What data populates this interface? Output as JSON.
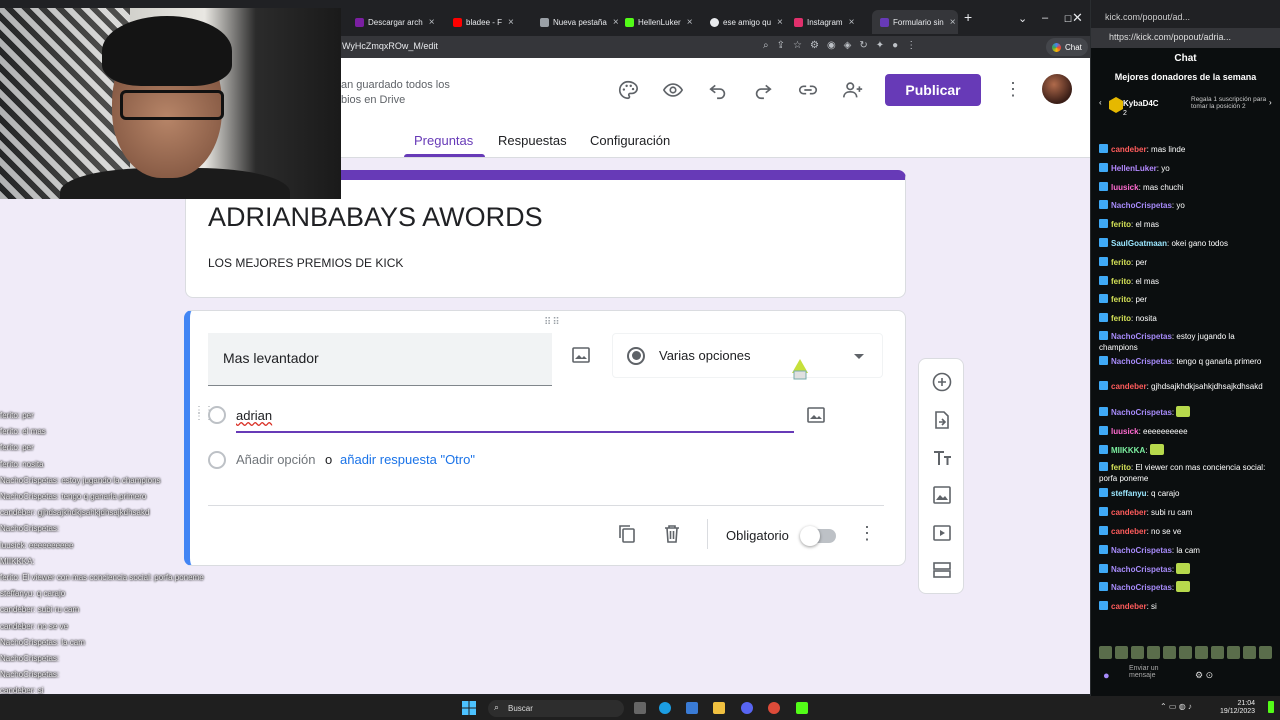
{
  "browser": {
    "tabs": [
      {
        "label": "Descargar arch",
        "color": "#7b1fa2"
      },
      {
        "label": "bladee - F",
        "color": "#ff0000"
      },
      {
        "label": "Nueva pestaña",
        "color": "#9aa0a6"
      },
      {
        "label": "HellenLuker",
        "color": "#53fc18"
      },
      {
        "label": "ese amigo qu",
        "color": "#e8eaed"
      },
      {
        "label": "Instagram",
        "color": "#e1306c"
      },
      {
        "label": "Formulario sin",
        "color": "#673ab7"
      }
    ],
    "url": "WyHcZmqxROw_M/edit",
    "chat_button": "Chat"
  },
  "forms": {
    "save_status": "an guardado todos los bios en Drive",
    "publish_label": "Publicar",
    "tabs": {
      "questions": "Preguntas",
      "responses": "Respuestas",
      "settings": "Configuración"
    },
    "title": "ADRIANBABAYS AWORDS",
    "description": "LOS MEJORES PREMIOS DE KICK",
    "question": {
      "title": "Mas levantador",
      "type": "Varias opciones",
      "option_1": "adrian",
      "add_option": "Añadir opción",
      "or": "o",
      "add_other": "añadir respuesta \"Otro\"",
      "required_label": "Obligatorio",
      "required": false
    }
  },
  "left_chat": [
    "ferito: per",
    "ferito: el mas",
    "ferito: per",
    "ferito: nosita",
    "NachoCrispetas: estoy jugando la champions",
    "NachoCrispetas: tengo q ganarla primero",
    "candeber: gjhdsajkhdkjsahkjdhsajkdhsakd",
    "NachoCrispetas:",
    "luusick: eeeeeeeeee",
    "MIIKKKA:",
    "ferito: El viewer con mas conciencia social: porfa poneme",
    "steffanyu: q carajo",
    "candeber: subi ru cam",
    "candeber: no se ve",
    "NachoCrispetas: la cam",
    "NachoCrispetas:",
    "NachoCrispetas:",
    "candeber: si"
  ],
  "kick": {
    "window_title": "kick.com/popout/ad...",
    "url": "https://kick.com/popout/adria...",
    "title": "Chat",
    "subtitle": "Mejores donadores de la semana",
    "top_donor": "KybaD4C",
    "top_donor_rank": "2",
    "donor_note": "Regala 1 suscripción para tomar la posición 2",
    "send_placeholder": "Enviar un mensaje",
    "messages": [
      {
        "user": "candeber",
        "text": "mas linde",
        "color": "#ff5c5c"
      },
      {
        "user": "HellenLuker",
        "text": "yo",
        "color": "#b388ff"
      },
      {
        "user": "luusick",
        "text": "mas chuchi",
        "color": "#ff6bd0"
      },
      {
        "user": "NachoCrispetas",
        "text": "yo",
        "color": "#a78bfa"
      },
      {
        "user": "ferito",
        "text": "el mas",
        "color": "#d4e157"
      },
      {
        "user": "SaulGoatmaan",
        "text": "okei gano todos",
        "color": "#9be7ff"
      },
      {
        "user": "ferito",
        "text": "per",
        "color": "#d4e157"
      },
      {
        "user": "ferito",
        "text": "el mas",
        "color": "#d4e157"
      },
      {
        "user": "ferito",
        "text": "per",
        "color": "#d4e157"
      },
      {
        "user": "ferito",
        "text": "nosita",
        "color": "#d4e157"
      },
      {
        "user": "NachoCrispetas",
        "text": "estoy jugando la champions",
        "color": "#a78bfa"
      },
      {
        "user": "NachoCrispetas",
        "text": "tengo q ganarla primero",
        "color": "#a78bfa"
      },
      {
        "user": "candeber",
        "text": "gjhdsajkhdkjsahkjdhsajkdhsakd",
        "color": "#ff5c5c"
      },
      {
        "user": "NachoCrispetas",
        "text": "",
        "color": "#a78bfa"
      },
      {
        "user": "luusick",
        "text": "eeeeeeeeee",
        "color": "#ff6bd0"
      },
      {
        "user": "MIIKKKA",
        "text": "",
        "color": "#7cf0a0"
      },
      {
        "user": "ferito",
        "text": "El viewer con mas conciencia social: porfa poneme",
        "color": "#d4e157"
      },
      {
        "user": "steffanyu",
        "text": "q carajo",
        "color": "#9be7ff"
      },
      {
        "user": "candeber",
        "text": "subi ru cam",
        "color": "#ff5c5c"
      },
      {
        "user": "candeber",
        "text": "no se ve",
        "color": "#ff5c5c"
      },
      {
        "user": "NachoCrispetas",
        "text": "la cam",
        "color": "#a78bfa"
      },
      {
        "user": "NachoCrispetas",
        "text": "",
        "color": "#a78bfa"
      },
      {
        "user": "NachoCrispetas",
        "text": "",
        "color": "#a78bfa"
      },
      {
        "user": "candeber",
        "text": "si",
        "color": "#ff5c5c"
      }
    ]
  },
  "taskbar": {
    "search_label": "Buscar",
    "time": "21:04",
    "date": "19/12/2023"
  }
}
